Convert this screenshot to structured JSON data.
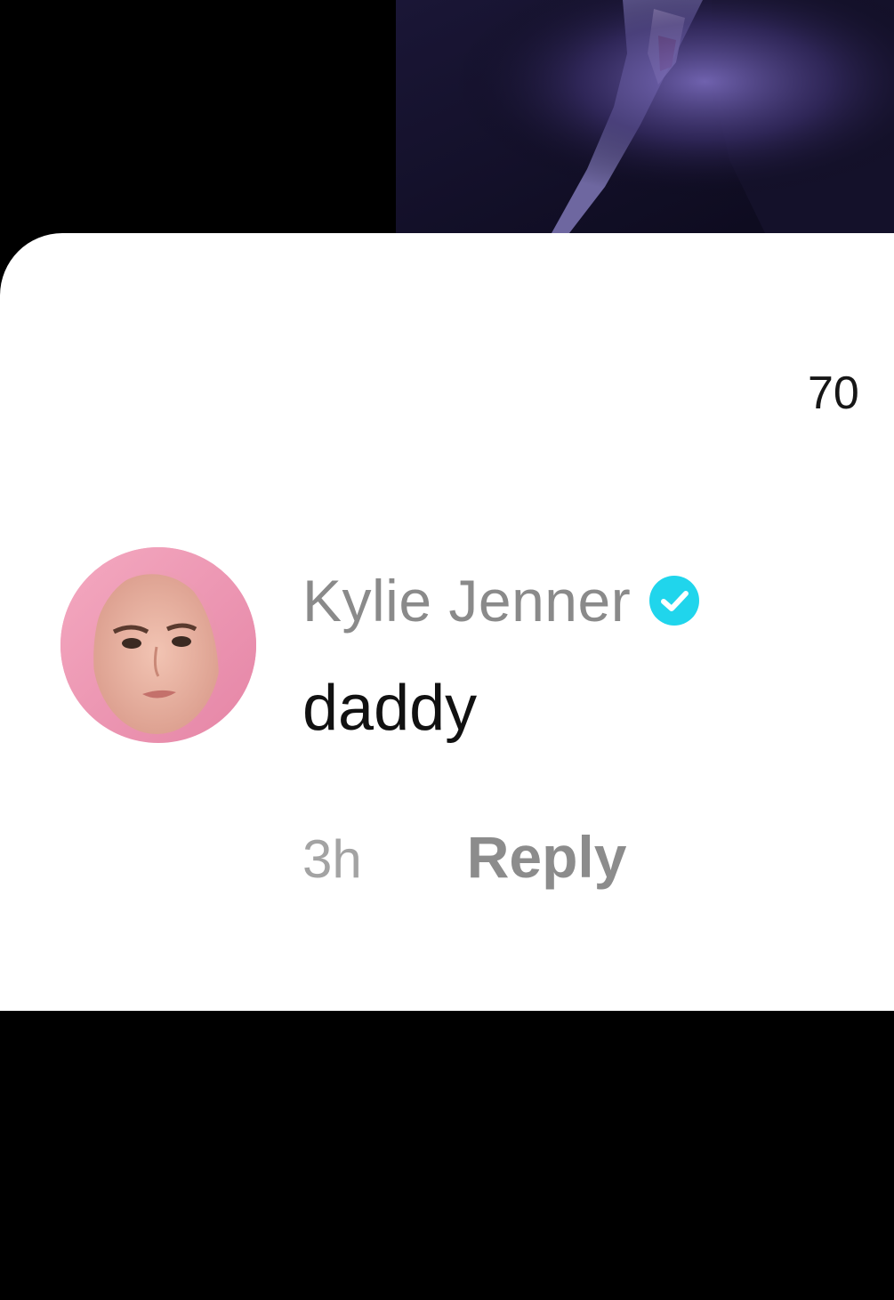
{
  "comments_sheet": {
    "comment_count_partial": "70",
    "comment": {
      "username": "Kylie Jenner",
      "verified_icon": "verified-badge-icon",
      "text": "daddy",
      "timestamp": "3h",
      "reply_label": "Reply"
    }
  },
  "colors": {
    "sheet_background": "#ffffff",
    "username": "#8a8a8a",
    "verified_badge": "#20d5ec",
    "timestamp": "#a3a3a3",
    "reply": "#8c8c8c",
    "backdrop": "#000000"
  }
}
